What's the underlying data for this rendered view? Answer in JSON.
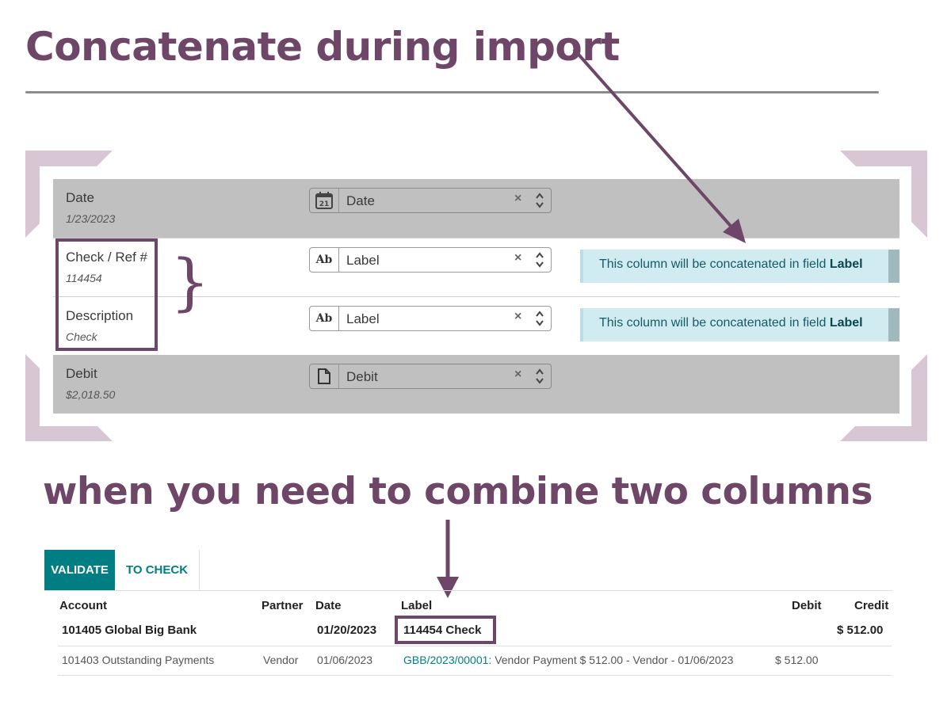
{
  "headline": "Concatenate during import",
  "subheadline": "when you need to combine two columns",
  "mapping_rows": [
    {
      "name": "Date",
      "sample": "1/23/2023",
      "icon": "calendar-icon",
      "icon_text": "21",
      "field": "Date",
      "clear": "×",
      "note": null
    },
    {
      "name": "Check / Ref #",
      "sample": "114454",
      "icon": "text-field-icon",
      "icon_text": "Ab",
      "field": "Label",
      "clear": "×",
      "note": {
        "text": "This column will be concatenated in field ",
        "field": "Label"
      }
    },
    {
      "name": "Description",
      "sample": "Check",
      "icon": "text-field-icon",
      "icon_text": "Ab",
      "field": "Label",
      "clear": "×",
      "note": {
        "text": "This column will be concatenated in field ",
        "field": "Label"
      }
    },
    {
      "name": "Debit",
      "sample": "$2,018.50",
      "icon": "document-icon",
      "icon_text": "",
      "field": "Debit",
      "clear": "×",
      "note": null
    }
  ],
  "tabs": {
    "validate": "VALIDATE",
    "to_check": "TO CHECK"
  },
  "table": {
    "headers": {
      "account": "Account",
      "partner": "Partner",
      "date": "Date",
      "label": "Label",
      "debit": "Debit",
      "credit": "Credit"
    },
    "rows": [
      {
        "account": "101405 Global Big Bank",
        "partner": "",
        "date": "01/20/2023",
        "label": "114454 Check",
        "label_suffix": "",
        "debit": "",
        "credit": "$ 512.00",
        "bold": true
      },
      {
        "account": "101403 Outstanding Payments",
        "partner": "Vendor",
        "date": "01/06/2023",
        "label": "GBB/2023/00001",
        "label_suffix": ": Vendor Payment $ 512.00 - Vendor - 01/06/2023",
        "debit": "$ 512.00",
        "credit": "",
        "bold": false
      }
    ]
  },
  "colors": {
    "accent": "#6e4667",
    "teal": "#017e84",
    "note_bg": "#d0ecf1",
    "row_grey": "#c0c0c1"
  }
}
